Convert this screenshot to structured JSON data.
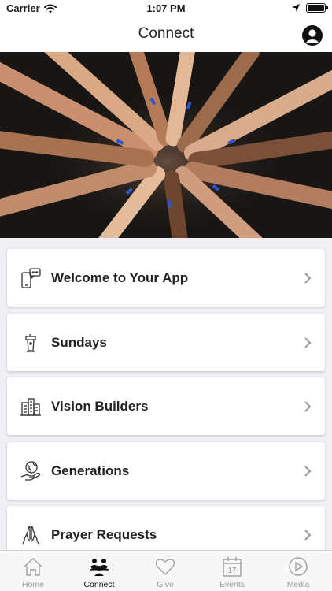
{
  "status": {
    "carrier": "Carrier",
    "time": "1:07 PM"
  },
  "header": {
    "title": "Connect"
  },
  "hero": {
    "alt": "hands together"
  },
  "items": [
    {
      "label": "Welcome to Your App",
      "icon": "chat-phone-icon"
    },
    {
      "label": "Sundays",
      "icon": "podium-icon"
    },
    {
      "label": "Vision Builders",
      "icon": "buildings-icon"
    },
    {
      "label": "Generations",
      "icon": "globe-hand-icon"
    },
    {
      "label": "Prayer Requests",
      "icon": "praying-hands-icon"
    }
  ],
  "tabs": [
    {
      "label": "Home",
      "icon": "home-icon",
      "active": false
    },
    {
      "label": "Connect",
      "icon": "people-icon",
      "active": true
    },
    {
      "label": "Give",
      "icon": "heart-icon",
      "active": false
    },
    {
      "label": "Events",
      "icon": "calendar-icon",
      "active": false,
      "day": "17"
    },
    {
      "label": "Media",
      "icon": "play-icon",
      "active": false
    }
  ]
}
